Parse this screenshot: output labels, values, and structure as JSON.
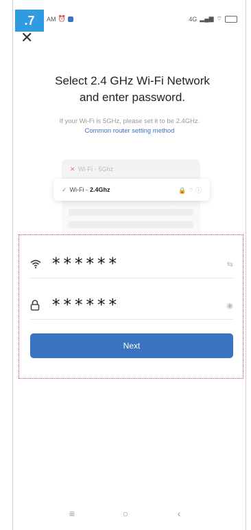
{
  "step_badge": ".7",
  "status": {
    "time": "AM",
    "right": "4G"
  },
  "header": {
    "close_label": "✕"
  },
  "title": {
    "line1": "Select 2.4 GHz Wi-Fi Network",
    "line2": "and enter password."
  },
  "hint": {
    "text": "If your Wi-Fi is 5GHz, please set it to be 2.4GHz.",
    "link": "Common router setting method"
  },
  "network_list": {
    "bad": {
      "mark": "✕",
      "prefix": "Wi-Fi -",
      "band": "5Ghz"
    },
    "good": {
      "mark": "✓",
      "prefix": "Wi-Fi -",
      "band": "2.4Ghz",
      "icons": "🔒 ⌔ ⓘ"
    }
  },
  "form": {
    "ssid_value": "******",
    "password_value": "******",
    "switch_icon": "⇆",
    "eye_icon": "◉"
  },
  "next_label": "Next",
  "nav": {
    "menu": "≡",
    "home": "○",
    "back": "‹"
  }
}
